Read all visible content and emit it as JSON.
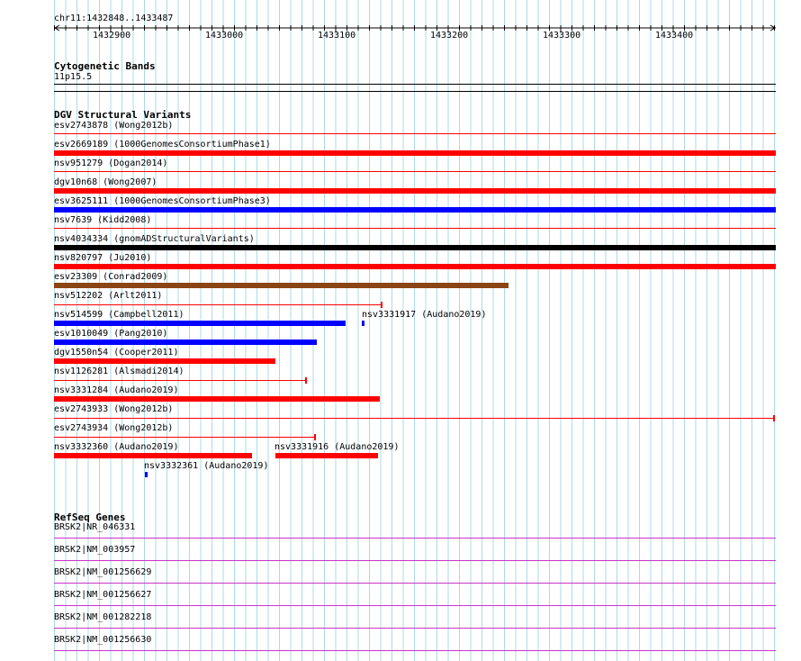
{
  "ruler": {
    "region": "chr11:1432848..1433487",
    "ticks": [
      "1432900",
      "1433000",
      "1433100",
      "1433200",
      "1433300",
      "1433400"
    ]
  },
  "cytobands": {
    "title": "Cytogenetic Bands",
    "band": "11p15.5"
  },
  "dgv": {
    "title": "DGV Structural Variants",
    "features": [
      {
        "label": "esv2743878 (Wong2012b)",
        "color": "#ff0000",
        "style": "thin-line"
      },
      {
        "label": "esv2669189 (1000GenomesConsortiumPhase1)",
        "color": "#ff0000",
        "style": "thick-bar"
      },
      {
        "label": "nsv951279 (Dogan2014)",
        "color": "#ff0000",
        "style": "thin-line"
      },
      {
        "label": "dgv10n68 (Wong2007)",
        "color": "#ff0000",
        "style": "thick-bar"
      },
      {
        "label": "esv3625111 (1000GenomesConsortiumPhase3)",
        "color": "#0000ff",
        "style": "thick-bar"
      },
      {
        "label": "nsv7639 (Kidd2008)",
        "color": "#ff0000",
        "style": "thin-line"
      },
      {
        "label": "nsv4034334 (gnomADStructuralVariants)",
        "color": "#000000",
        "style": "thick-bar"
      },
      {
        "label": "nsv820797 (Ju2010)",
        "color": "#ff0000",
        "style": "thick-bar"
      },
      {
        "label": "esv23309 (Conrad2009)",
        "color": "#8b4513",
        "style": "thick-bar"
      },
      {
        "label": "nsv512202 (Arlt2011)",
        "color": "#ff0000",
        "style": "thin-line-with-end-cap"
      },
      {
        "label": "nsv514599 (Campbell2011)",
        "color": "#0000ff",
        "style": "thick-bar"
      },
      {
        "label": "nsv3331917 (Audano2019)",
        "color": "#0000ff",
        "style": "small-mark"
      },
      {
        "label": "esv1010049 (Pang2010)",
        "color": "#0000ff",
        "style": "thick-bar"
      },
      {
        "label": "dgv1550n54 (Cooper2011)",
        "color": "#ff0000",
        "style": "thick-bar"
      },
      {
        "label": "nsv1126281 (Alsmadi2014)",
        "color": "#ff0000",
        "style": "thin-line-with-end-cap"
      },
      {
        "label": "nsv3331284 (Audano2019)",
        "color": "#ff0000",
        "style": "thick-bar"
      },
      {
        "label": "esv2743933 (Wong2012b)",
        "color": "#ff0000",
        "style": "thin-line-with-end-cap"
      },
      {
        "label": "esv2743934 (Wong2012b)",
        "color": "#ff0000",
        "style": "thin-line-with-end-cap"
      },
      {
        "label": "nsv3332360 (Audano2019)",
        "color": "#ff0000",
        "style": "thick-bar"
      },
      {
        "label": "nsv3331916 (Audano2019)",
        "color": "#ff0000",
        "style": "thick-bar"
      },
      {
        "label": "nsv3332361 (Audano2019)",
        "color": "#0000ff",
        "style": "small-mark"
      }
    ]
  },
  "refseq": {
    "title": "RefSeq Genes",
    "genes": [
      "BRSK2|NR_046331",
      "BRSK2|NM_003957",
      "BRSK2|NM_001256629",
      "BRSK2|NM_001256627",
      "BRSK2|NM_001282218",
      "BRSK2|NM_001256630"
    ],
    "color": "#cc33cc"
  },
  "colors": {
    "grid_line": "#add8e6",
    "red": "#ff0000",
    "blue": "#0000ff",
    "black": "#000000",
    "brown": "#8b4513",
    "gene": "#cc33cc"
  }
}
